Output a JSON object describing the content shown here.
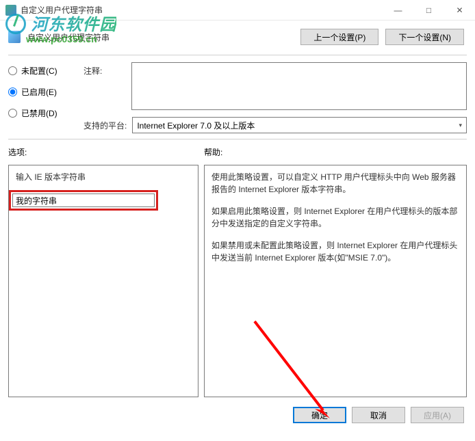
{
  "window": {
    "title": "自定义用户代理字符串",
    "minimize": "—",
    "maximize": "□",
    "close": "✕"
  },
  "header": {
    "title": "自定义用户代理字符串",
    "prev_btn": "上一个设置(P)",
    "next_btn": "下一个设置(N)"
  },
  "radios": {
    "not_configured": "未配置(C)",
    "enabled": "已启用(E)",
    "disabled": "已禁用(D)"
  },
  "fields": {
    "comment_label": "注释:",
    "platform_label": "支持的平台:",
    "platform_value": "Internet Explorer 7.0 及以上版本"
  },
  "labels": {
    "options": "选项:",
    "help": "帮助:"
  },
  "options": {
    "input_label": "输入 IE 版本字符串",
    "input_value": "我的字符串"
  },
  "help": {
    "p1": "使用此策略设置，可以自定义 HTTP 用户代理标头中向 Web 服务器报告的 Internet Explorer 版本字符串。",
    "p2": "如果启用此策略设置，则 Internet Explorer 在用户代理标头的版本部分中发送指定的自定义字符串。",
    "p3": "如果禁用或未配置此策略设置，则 Internet Explorer 在用户代理标头中发送当前 Internet Explorer 版本(如\"MSIE 7.0\")。"
  },
  "buttons": {
    "ok": "确定",
    "cancel": "取消",
    "apply": "应用(A)"
  },
  "watermark": {
    "text": "河东软件园",
    "url": "www.pc0359.cn"
  },
  "colors": {
    "highlight_border": "#d6201e",
    "focus_border": "#0078d7",
    "arrow": "#ff0000"
  }
}
